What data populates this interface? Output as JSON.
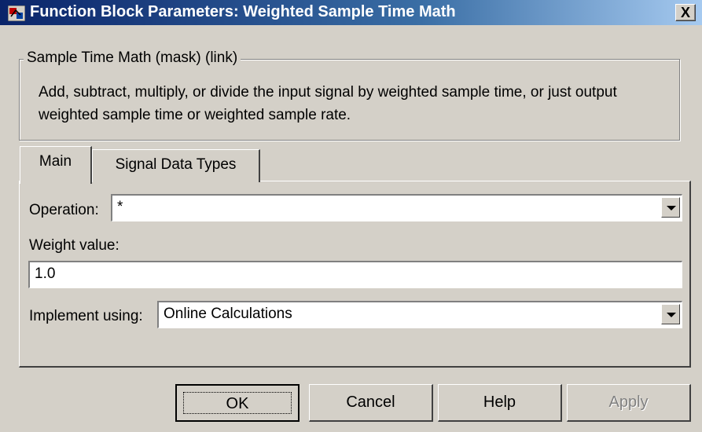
{
  "window": {
    "title": "Function Block Parameters: Weighted Sample Time Math",
    "close_label": "X"
  },
  "mask": {
    "group_title": "Sample Time Math (mask) (link)",
    "description": "Add, subtract, multiply, or divide the input signal by weighted sample time, or just output weighted sample time or weighted sample rate."
  },
  "tabs": [
    {
      "label": "Main",
      "selected": true
    },
    {
      "label": "Signal Data Types",
      "selected": false
    }
  ],
  "params": {
    "operation_label": "Operation:",
    "operation_value": "*",
    "weight_label": "Weight value:",
    "weight_value": "1.0",
    "implement_label": "Implement using:",
    "implement_value": "Online Calculations"
  },
  "buttons": {
    "ok": "OK",
    "cancel": "Cancel",
    "help": "Help",
    "apply": "Apply"
  }
}
